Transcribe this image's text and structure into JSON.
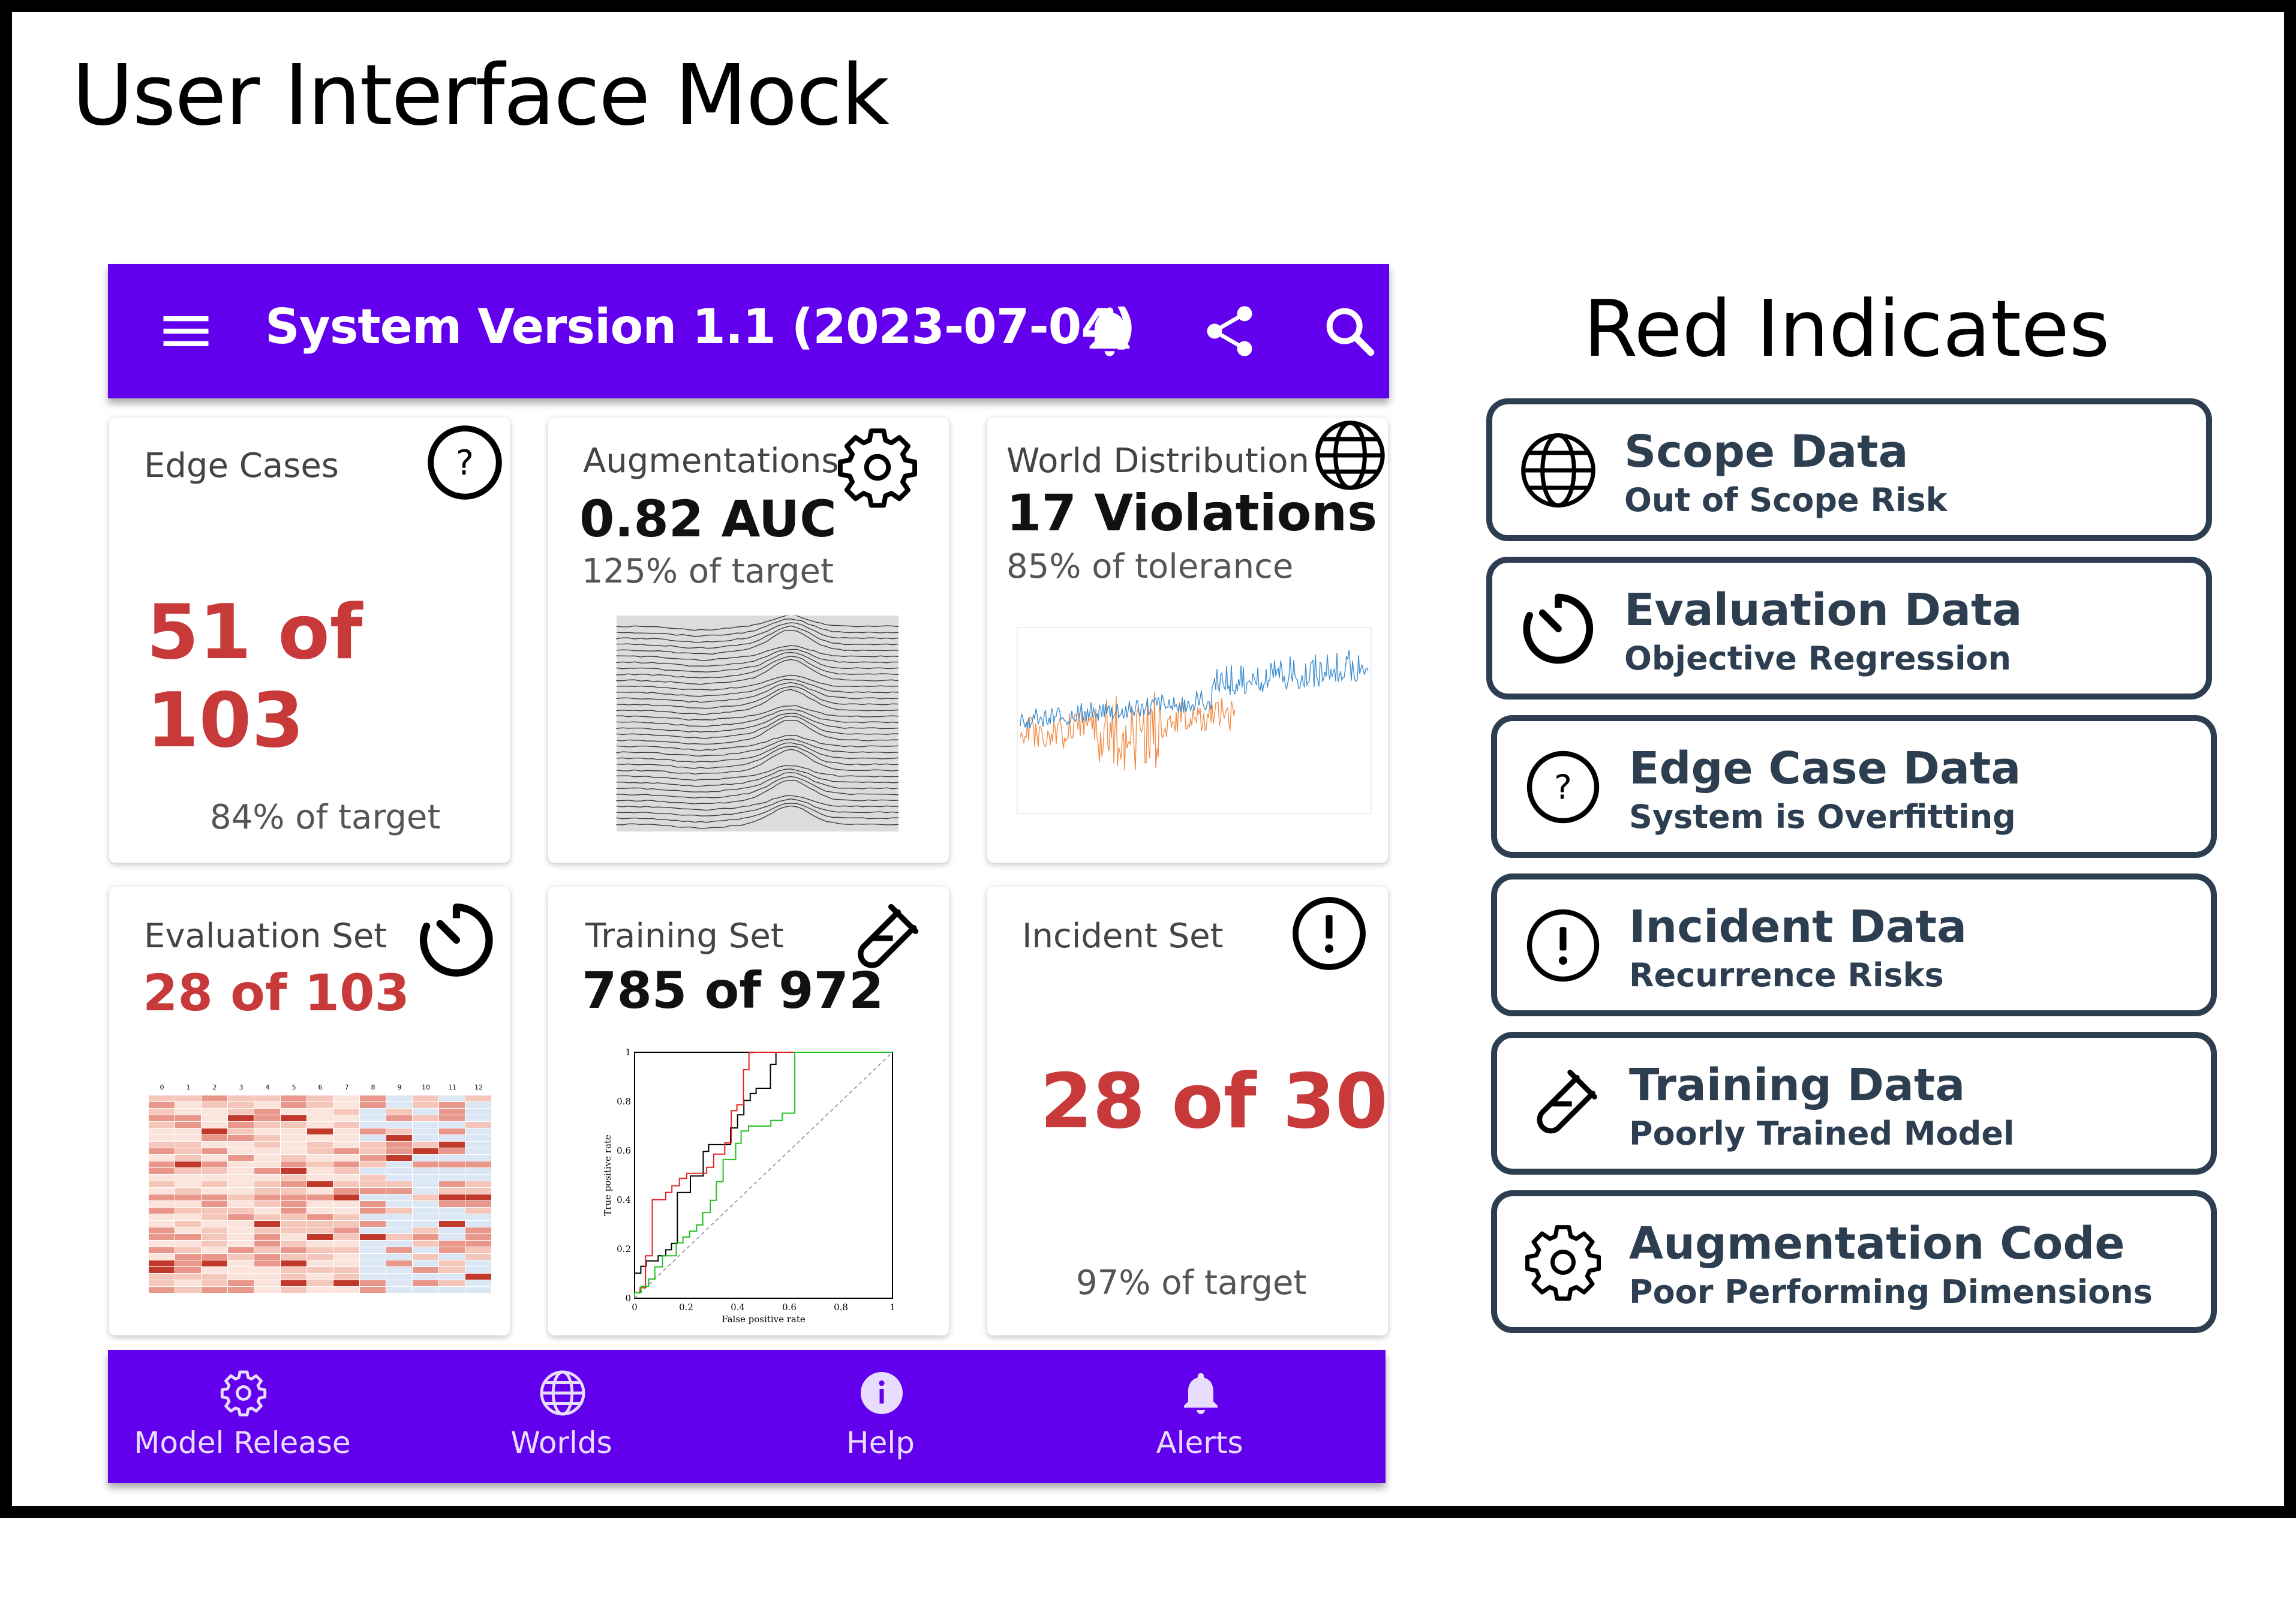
{
  "page": {
    "title": "User Interface Mock"
  },
  "app_bar": {
    "title": "System Version 1.1 (2023-07-04)",
    "icons": [
      "menu-icon",
      "bell-icon",
      "share-icon",
      "search-icon"
    ]
  },
  "cards": {
    "edge_cases": {
      "label": "Edge Cases",
      "value": "51 of 103",
      "sub": "84% of target",
      "icon": "question-icon"
    },
    "augmentations": {
      "label": "Augmentations",
      "value": "0.82 AUC",
      "sub": "125% of target",
      "icon": "gear-icon"
    },
    "world_distribution": {
      "label": "World Distribution",
      "value": "17 Violations",
      "sub": "85% of tolerance",
      "icon": "globe-icon"
    },
    "evaluation_set": {
      "label": "Evaluation Set",
      "value": "28 of 103",
      "icon": "timer-icon"
    },
    "training_set": {
      "label": "Training Set",
      "value": "785 of 972",
      "icon": "test-tube-icon"
    },
    "incident_set": {
      "label": "Incident Set",
      "value": "28 of 30",
      "sub": "97% of target",
      "icon": "exclamation-icon"
    }
  },
  "roc_chart": {
    "xlabel": "False positive rate",
    "ylabel": "True positive rate",
    "ticks": [
      "0",
      "0.2",
      "0.4",
      "0.6",
      "0.8",
      "1"
    ]
  },
  "heatmap": {
    "columns": [
      "0",
      "1",
      "2",
      "3",
      "4",
      "5",
      "6",
      "7",
      "8",
      "9",
      "10",
      "11",
      "12"
    ]
  },
  "bottom_nav": {
    "items": [
      {
        "label": "Model Release",
        "icon": "gear-icon"
      },
      {
        "label": "Worlds",
        "icon": "globe-icon"
      },
      {
        "label": "Help",
        "icon": "info-icon"
      },
      {
        "label": "Alerts",
        "icon": "bell-icon"
      }
    ]
  },
  "legend": {
    "title": "Red Indicates",
    "items": [
      {
        "head": "Scope Data",
        "sub": "Out of Scope Risk",
        "icon": "globe-icon"
      },
      {
        "head": "Evaluation Data",
        "sub": "Objective Regression",
        "icon": "timer-icon"
      },
      {
        "head": "Edge Case Data",
        "sub": "System is Overfitting",
        "icon": "question-icon"
      },
      {
        "head": "Incident Data",
        "sub": "Recurrence Risks",
        "icon": "exclamation-icon"
      },
      {
        "head": "Training Data",
        "sub": "Poorly Trained Model",
        "icon": "test-tube-icon"
      },
      {
        "head": "Augmentation Code",
        "sub": "Poor Performing Dimensions",
        "icon": "gear-icon"
      }
    ]
  },
  "colors": {
    "primary": "#6200ee",
    "alert_red": "#c83a3a",
    "legend_border": "#2c3e50"
  }
}
